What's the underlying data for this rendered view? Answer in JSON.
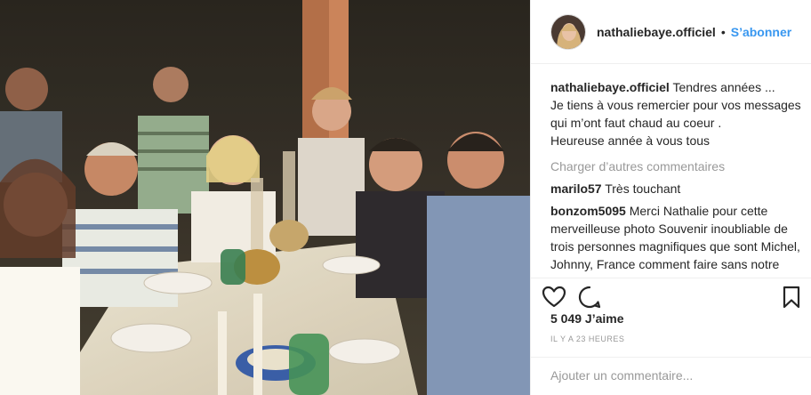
{
  "header": {
    "username": "nathaliebaye.officiel",
    "separator": "•",
    "follow_label": "S’abonner"
  },
  "caption": {
    "username": "nathaliebaye.officiel",
    "text": "Tendres années ...\nJe tiens à vous remercier pour vos messages qui m’ont faut chaud au coeur .\nHeureuse année à vous tous"
  },
  "load_more_label": "Charger d’autres commentaires",
  "comments": [
    {
      "username": "marilo57",
      "text": "Très touchant"
    },
    {
      "username": "bonzom5095",
      "text": "Merci Nathalie pour cette merveilleuse photo Souvenir inoubliable de trois personnes magnifiques que sont Michel, Johnny, France comment faire sans notre Johnny !!!"
    }
  ],
  "likes": "5 049 J’aime",
  "timestamp": "IL Y A 23 HEURES",
  "add_comment_placeholder": "Ajouter un commentaire...",
  "icons": {
    "like": "heart-icon",
    "comment": "comment-bubble-icon",
    "save": "bookmark-icon"
  },
  "colors": {
    "accent": "#3897f0",
    "text": "#262626",
    "muted": "#999999",
    "border": "#efefef"
  }
}
